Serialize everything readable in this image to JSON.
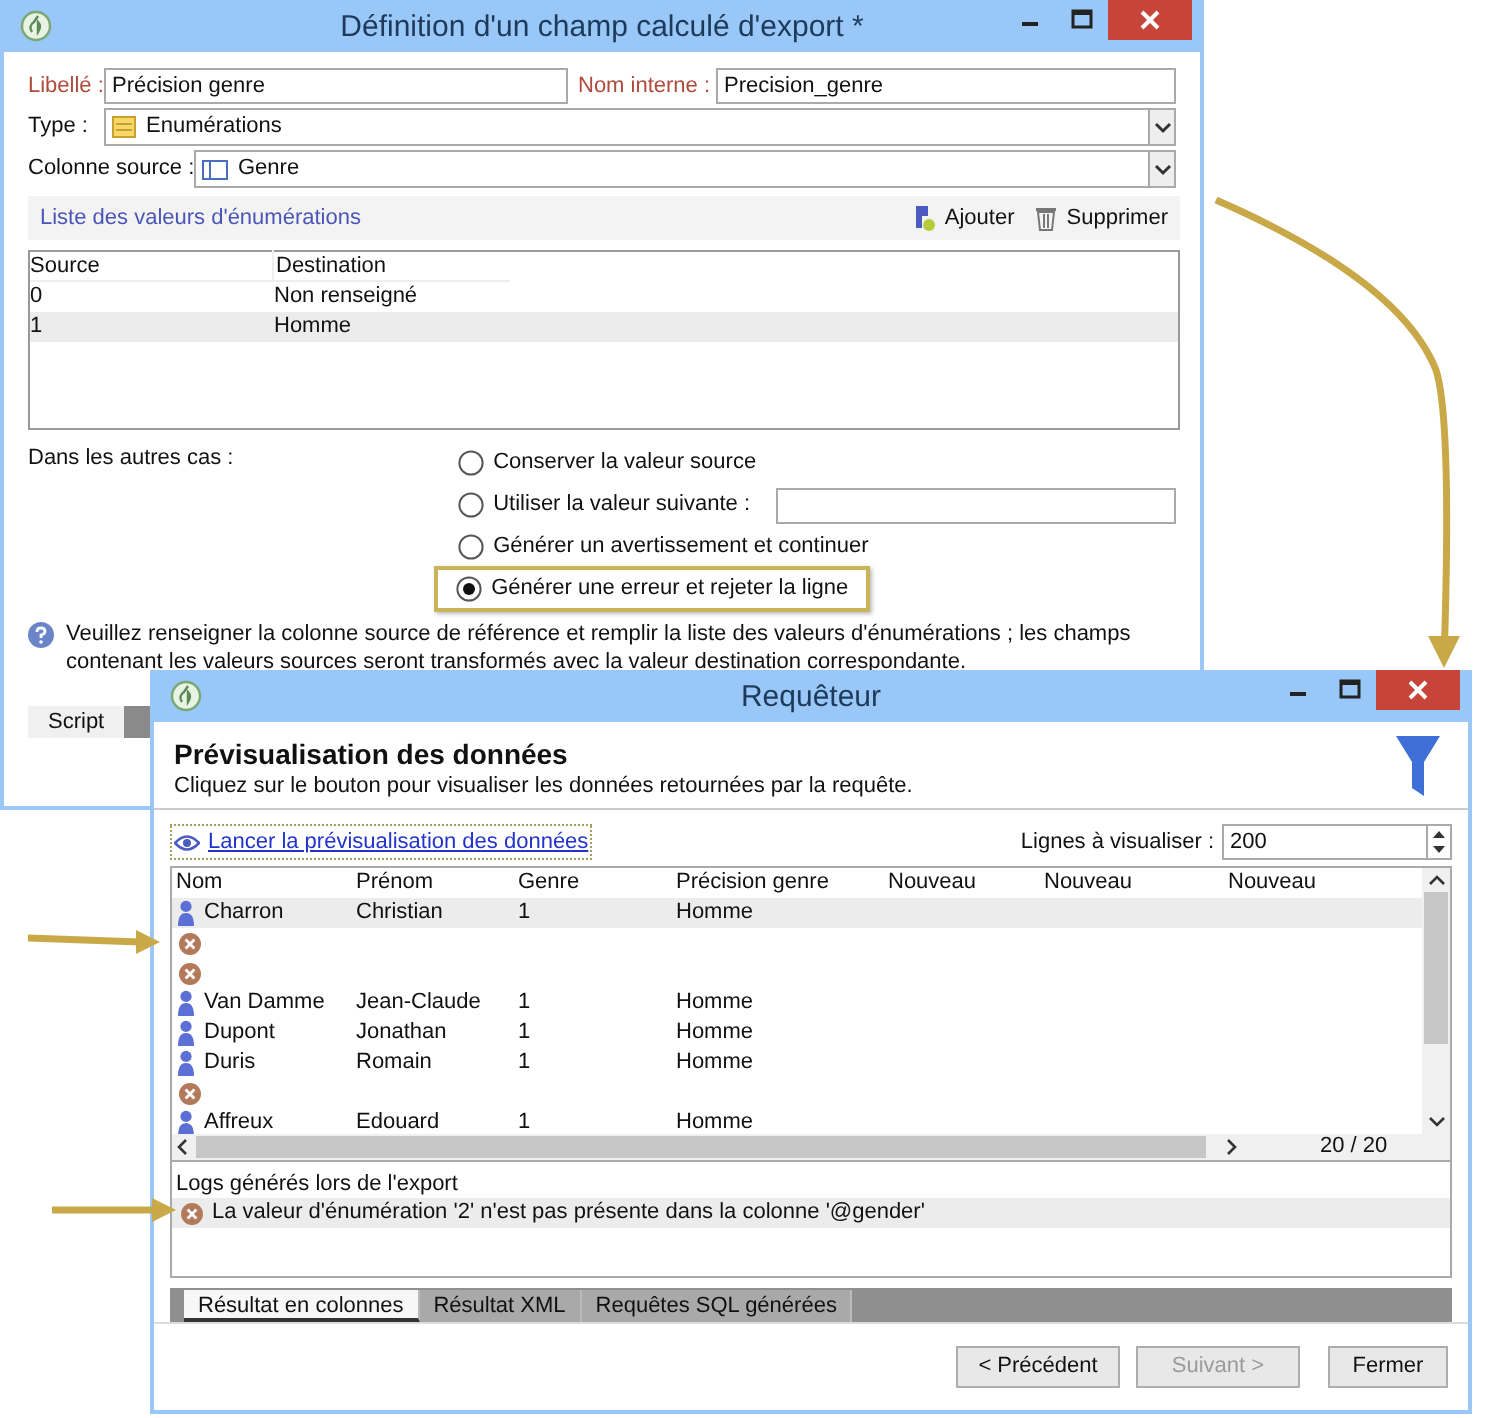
{
  "export_window": {
    "title": "Définition d'un champ calculé d'export *",
    "label_field": {
      "label": "Libellé :",
      "value": "Précision genre"
    },
    "internal_name_field": {
      "label": "Nom interne :",
      "value": "Precision_genre"
    },
    "type_field": {
      "label": "Type :",
      "value": "Enumérations"
    },
    "source_column_field": {
      "label": "Colonne source :",
      "value": "Genre"
    },
    "enum_list": {
      "title": "Liste des valeurs d'énumérations",
      "buttons": [
        "Ajouter",
        "Supprimer"
      ],
      "columns": [
        "Source",
        "Destination"
      ],
      "rows": [
        {
          "cells": [
            "0",
            "Non renseigné"
          ],
          "selected": false
        },
        {
          "cells": [
            "1",
            "Homme"
          ],
          "selected": true
        }
      ]
    },
    "other_cases": {
      "label": "Dans les autres cas :",
      "options": [
        {
          "label": "Conserver la valeur source",
          "selected": false,
          "kind": "plain",
          "highlighted": false
        },
        {
          "label": "Utiliser la valeur suivante :",
          "selected": false,
          "kind": "with_field",
          "highlighted": false
        },
        {
          "label": "Générer un avertissement et continuer",
          "selected": false,
          "kind": "plain",
          "highlighted": false
        },
        {
          "label": "Générer une erreur et rejeter la ligne",
          "selected": true,
          "kind": "plain",
          "highlighted": true
        }
      ]
    },
    "help": "Veuillez renseigner la colonne source de référence et remplir la liste des valeurs d'énumérations ; les champs contenant les valeurs sources seront transformés avec la valeur destination correspondante.",
    "tabs": [
      {
        "label": "Script",
        "selected": true
      }
    ]
  },
  "query_window": {
    "title": "Requêteur",
    "heading": "Prévisualisation des données",
    "subtitle": "Cliquez sur le bouton pour visualiser les données retournées par la requête.",
    "preview_link": "Lancer la prévisualisation des données",
    "lines": {
      "label": "Lignes à visualiser :",
      "value": "200"
    },
    "columns": [
      "Nom",
      "Prénom",
      "Genre",
      "Précision genre",
      "Nouveau",
      "Nouveau",
      "Nouveau"
    ],
    "rows": [
      {
        "kind": "contact",
        "cells": [
          "Charron",
          "Christian",
          "1",
          "Homme"
        ],
        "selected": true
      },
      {
        "kind": "error",
        "cells": [],
        "selected": false
      },
      {
        "kind": "error",
        "cells": [],
        "selected": false
      },
      {
        "kind": "contact",
        "cells": [
          "Van Damme",
          "Jean-Claude",
          "1",
          "Homme"
        ],
        "selected": false
      },
      {
        "kind": "contact",
        "cells": [
          "Dupont",
          "Jonathan",
          "1",
          "Homme"
        ],
        "selected": false
      },
      {
        "kind": "contact",
        "cells": [
          "Duris",
          "Romain",
          "1",
          "Homme"
        ],
        "selected": false
      },
      {
        "kind": "error",
        "cells": [],
        "selected": false
      },
      {
        "kind": "contact",
        "cells": [
          "Affreux",
          "Edouard",
          "1",
          "Homme"
        ],
        "selected": false
      }
    ],
    "counter": "20 / 20",
    "logs": {
      "title": "Logs générés lors de l'export",
      "entries": [
        "La valeur d'énumération '2' n'est pas présente dans la colonne '@gender'"
      ]
    },
    "tabs": [
      {
        "label": "Résultat en colonnes",
        "selected": true
      },
      {
        "label": "Résultat XML",
        "selected": false
      },
      {
        "label": "Requêtes SQL générées",
        "selected": false
      }
    ],
    "buttons": [
      {
        "label": "< Précédent",
        "disabled": false
      },
      {
        "label": "Suivant >",
        "disabled": true
      },
      {
        "label": "Fermer",
        "disabled": false
      }
    ]
  }
}
